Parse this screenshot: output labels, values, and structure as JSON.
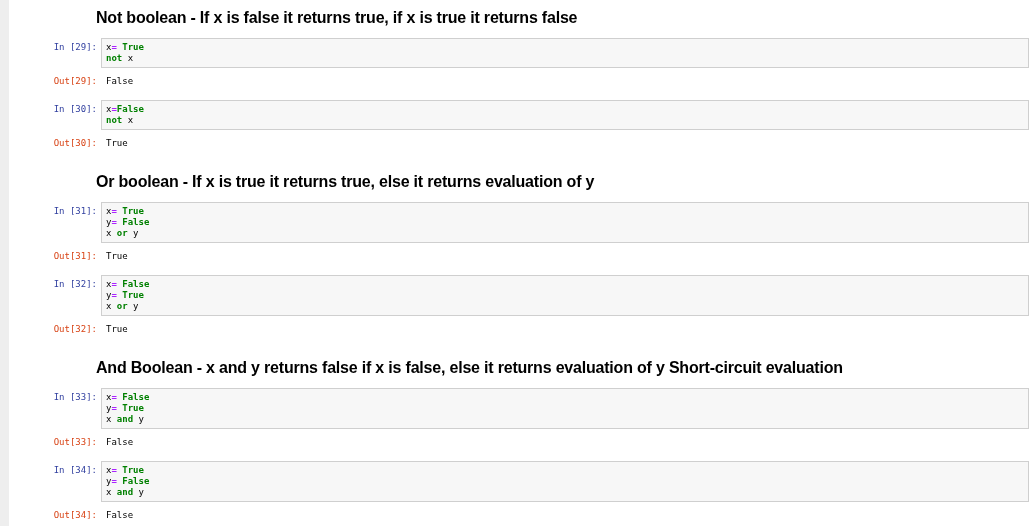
{
  "sections": [
    {
      "heading": "Not boolean - If x is false it returns true, if x is true it returns false",
      "cells": [
        {
          "in_prompt": "In [29]:",
          "code": [
            [
              {
                "text": "x",
                "kind": "name"
              },
              {
                "text": "=",
                "kind": "op"
              },
              {
                "text": " True",
                "kind": "keyword"
              }
            ],
            [
              {
                "text": "not",
                "kind": "keyword"
              },
              {
                "text": " x",
                "kind": "name"
              }
            ]
          ],
          "out_prompt": "Out[29]:",
          "output": "False"
        },
        {
          "in_prompt": "In [30]:",
          "code": [
            [
              {
                "text": "x",
                "kind": "name"
              },
              {
                "text": "=",
                "kind": "op"
              },
              {
                "text": "False",
                "kind": "keyword"
              }
            ],
            [
              {
                "text": "not",
                "kind": "keyword"
              },
              {
                "text": " x",
                "kind": "name"
              }
            ]
          ],
          "out_prompt": "Out[30]:",
          "output": "True"
        }
      ]
    },
    {
      "heading": "Or boolean - If x is true it returns true, else it returns evaluation of y",
      "cells": [
        {
          "in_prompt": "In [31]:",
          "code": [
            [
              {
                "text": "x",
                "kind": "name"
              },
              {
                "text": "=",
                "kind": "op"
              },
              {
                "text": " True",
                "kind": "keyword"
              }
            ],
            [
              {
                "text": "y",
                "kind": "name"
              },
              {
                "text": "=",
                "kind": "op"
              },
              {
                "text": " False",
                "kind": "keyword"
              }
            ],
            [
              {
                "text": "x ",
                "kind": "name"
              },
              {
                "text": "or",
                "kind": "keyword"
              },
              {
                "text": " y",
                "kind": "name"
              }
            ]
          ],
          "out_prompt": "Out[31]:",
          "output": "True"
        },
        {
          "in_prompt": "In [32]:",
          "code": [
            [
              {
                "text": "x",
                "kind": "name"
              },
              {
                "text": "=",
                "kind": "op"
              },
              {
                "text": " False",
                "kind": "keyword"
              }
            ],
            [
              {
                "text": "y",
                "kind": "name"
              },
              {
                "text": "=",
                "kind": "op"
              },
              {
                "text": " True",
                "kind": "keyword"
              }
            ],
            [
              {
                "text": "x ",
                "kind": "name"
              },
              {
                "text": "or",
                "kind": "keyword"
              },
              {
                "text": " y",
                "kind": "name"
              }
            ]
          ],
          "out_prompt": "Out[32]:",
          "output": "True"
        }
      ]
    },
    {
      "heading": "And Boolean - x and y returns false if x is false, else it returns evaluation of y Short-circuit evaluation",
      "cells": [
        {
          "in_prompt": "In [33]:",
          "code": [
            [
              {
                "text": "x",
                "kind": "name"
              },
              {
                "text": "=",
                "kind": "op"
              },
              {
                "text": " False",
                "kind": "keyword"
              }
            ],
            [
              {
                "text": "y",
                "kind": "name"
              },
              {
                "text": "=",
                "kind": "op"
              },
              {
                "text": " True",
                "kind": "keyword"
              }
            ],
            [
              {
                "text": "x ",
                "kind": "name"
              },
              {
                "text": "and",
                "kind": "keyword"
              },
              {
                "text": " y",
                "kind": "name"
              }
            ]
          ],
          "out_prompt": "Out[33]:",
          "output": "False"
        },
        {
          "in_prompt": "In [34]:",
          "code": [
            [
              {
                "text": "x",
                "kind": "name"
              },
              {
                "text": "=",
                "kind": "op"
              },
              {
                "text": " True",
                "kind": "keyword"
              }
            ],
            [
              {
                "text": "y",
                "kind": "name"
              },
              {
                "text": "=",
                "kind": "op"
              },
              {
                "text": " False",
                "kind": "keyword"
              }
            ],
            [
              {
                "text": "x ",
                "kind": "name"
              },
              {
                "text": "and",
                "kind": "keyword"
              },
              {
                "text": " y",
                "kind": "name"
              }
            ]
          ],
          "out_prompt": "Out[34]:",
          "output": "False"
        }
      ]
    }
  ]
}
